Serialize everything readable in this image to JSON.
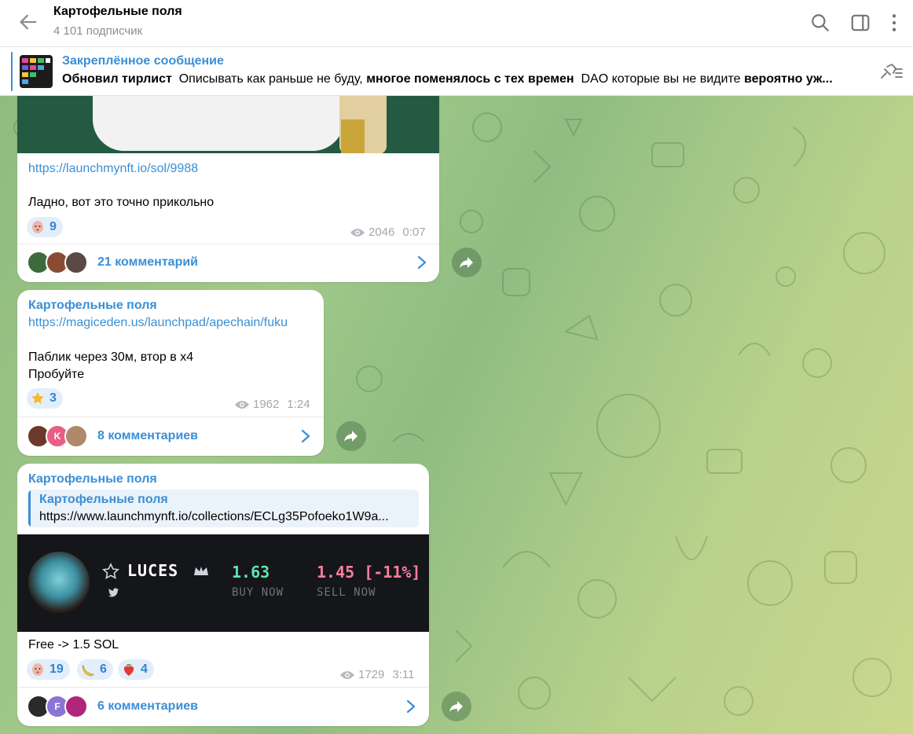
{
  "header": {
    "title": "Картофельные поля",
    "subtitle": "4 101 подписчик"
  },
  "pinned": {
    "title": "Закреплённое сообщение",
    "text_parts": [
      "Обновил тирлист",
      "Описывать как раньше не буду,",
      "многое поменялось с тех времен",
      "DAO которые вы не видите",
      "вероятно уж..."
    ]
  },
  "messages": [
    {
      "link": "https://launchmynft.io/sol/9988",
      "text": "Ладно, вот это точно прикольно",
      "reactions": [
        {
          "emoji": "face",
          "count": "9"
        }
      ],
      "views": "2046",
      "time": "0:07",
      "comments": "21 комментарий"
    },
    {
      "sender": "Картофельные поля",
      "link": "https://magiceden.us/launchpad/apechain/fuku",
      "text_lines": [
        "Паблик через 30м, втор в х4",
        "Пробуйте"
      ],
      "reactions": [
        {
          "emoji": "star",
          "count": "3"
        }
      ],
      "views": "1962",
      "time": "1:24",
      "comments": "8 комментариев",
      "avatar_letter": "K"
    },
    {
      "sender": "Картофельные поля",
      "quote_title": "Картофельные поля",
      "quote_text": "https://www.launchmynft.io/collections/ECLg35Pofoeko1W9a...",
      "preview": {
        "name": "LUCES",
        "buy_price": "1.63",
        "buy_label": "BUY NOW",
        "sell_price": "1.45 [-11%]",
        "sell_label": "SELL NOW"
      },
      "text": "Free -> 1.5 SOL",
      "reactions": [
        {
          "emoji": "face",
          "count": "19"
        },
        {
          "emoji": "banana",
          "count": "6"
        },
        {
          "emoji": "strawberry",
          "count": "4"
        }
      ],
      "views": "1729",
      "time": "3:11",
      "comments": "6 комментариев",
      "avatar_letter": "F"
    }
  ],
  "colors": {
    "accent": "#3a8fd6",
    "buy": "#5ce7b0",
    "sell": "#ff7d9c"
  },
  "icons": [
    "back-arrow-icon",
    "search-icon",
    "sidebar-toggle-icon",
    "more-vertical-icon",
    "unpin-icon",
    "eye-icon",
    "chevron-right-icon",
    "forward-icon",
    "star-outline-icon",
    "crown-icon",
    "twitter-icon"
  ]
}
